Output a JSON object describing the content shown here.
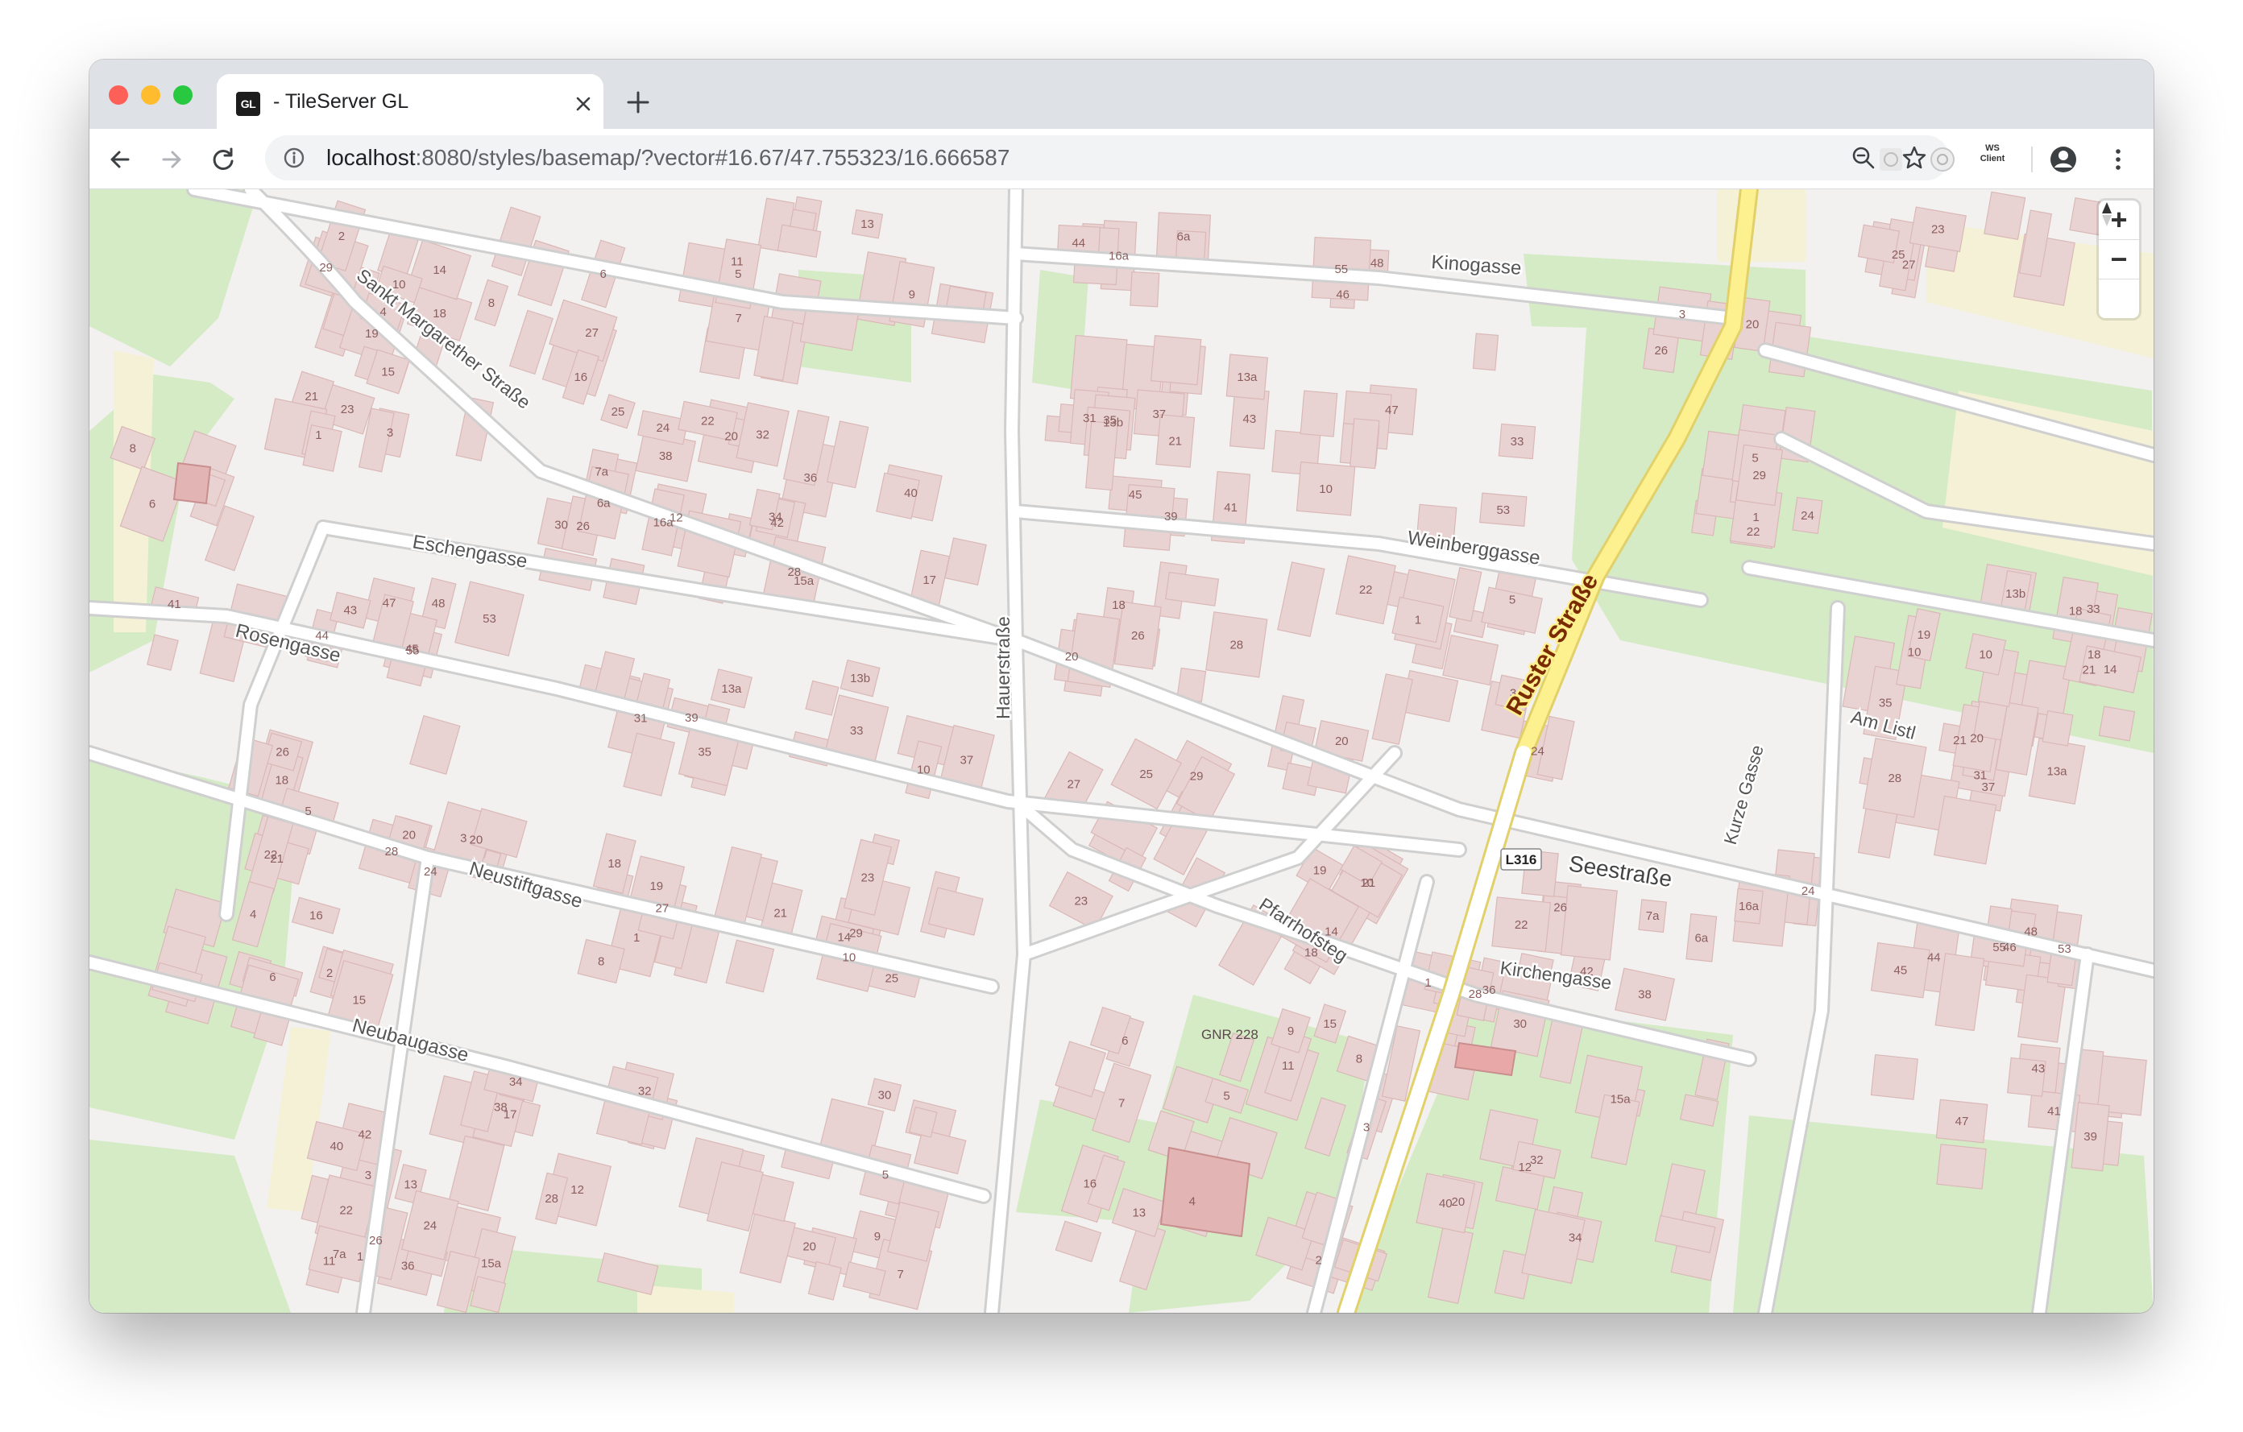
{
  "window": {
    "traffic_lights": {
      "close": "#fe5f57",
      "minimize": "#febc2e",
      "zoom": "#28c840"
    }
  },
  "tab": {
    "favicon_text": "GL",
    "title": "- TileServer GL",
    "close_icon": "close-icon",
    "new_tab_icon": "plus-icon"
  },
  "toolbar": {
    "url_host": "localhost",
    "url_rest": ":8080/styles/basemap/?vector#16.67/47.755323/16.666587",
    "ext_ws_line1": "WS",
    "ext_ws_line2": "Client",
    "icons": [
      "back-icon",
      "forward-icon",
      "reload-icon",
      "info-icon",
      "zoom-out-icon",
      "star-icon",
      "extension-icon",
      "extension-icon",
      "profile-icon",
      "menu-kebab-icon"
    ]
  },
  "map": {
    "colors": {
      "background": "#f2f1ef",
      "park": "#d4ebc6",
      "building": "#e9d3d2",
      "building_stroke": "#d9b8b7",
      "road": "#ffffff",
      "road_casing": "#cfcfcf",
      "primary_road": "#fdf08f",
      "primary_casing": "#e2d06a",
      "label": "#555555",
      "house_number": "#8b5e5e",
      "farmland": "#f4f1d6"
    },
    "controls": {
      "zoom_in": "+",
      "zoom_out": "−",
      "compass": "compass-icon"
    },
    "street_labels": [
      {
        "id": "kinogasse",
        "text": "Kinogasse"
      },
      {
        "id": "sankt-margarether",
        "text": "Sankt Margarether Straße"
      },
      {
        "id": "eschengasse",
        "text": "Eschengasse"
      },
      {
        "id": "rosengasse",
        "text": "Rosengasse"
      },
      {
        "id": "weinberggasse",
        "text": "Weinberggasse"
      },
      {
        "id": "ruster",
        "text": "Ruster Straße"
      },
      {
        "id": "hauerstrasse",
        "text": "Hauerstraße"
      },
      {
        "id": "am-listl",
        "text": "Am Listl"
      },
      {
        "id": "kurze-gasse",
        "text": "Kurze Gasse"
      },
      {
        "id": "seestrasse",
        "text": "Seestraße"
      },
      {
        "id": "neustiftgasse",
        "text": "Neustiftgasse"
      },
      {
        "id": "pfarrhofsteg",
        "text": "Pfarrhofsteg"
      },
      {
        "id": "kirchengasse",
        "text": "Kirchengasse"
      },
      {
        "id": "neubaugasse",
        "text": "Neubaugasse"
      }
    ],
    "road_shield": "L316",
    "poi_label": "GNR 228",
    "house_numbers": [
      "29",
      "27",
      "25",
      "23",
      "21",
      "19",
      "18",
      "14",
      "10",
      "8",
      "6",
      "2",
      "16",
      "4",
      "15",
      "13",
      "11",
      "9",
      "7",
      "5",
      "3",
      "1",
      "17",
      "20",
      "15a",
      "12",
      "36",
      "42",
      "40",
      "38",
      "34",
      "32",
      "30",
      "28",
      "26",
      "24",
      "22",
      "7a",
      "16a",
      "6a",
      "48",
      "46",
      "44",
      "55",
      "53",
      "45",
      "47",
      "43",
      "41",
      "39",
      "37",
      "35",
      "33",
      "31",
      "13a",
      "13b",
      "10",
      "21",
      "20",
      "18",
      "28",
      "26",
      "24",
      "22",
      "20",
      "5",
      "3",
      "1"
    ]
  }
}
